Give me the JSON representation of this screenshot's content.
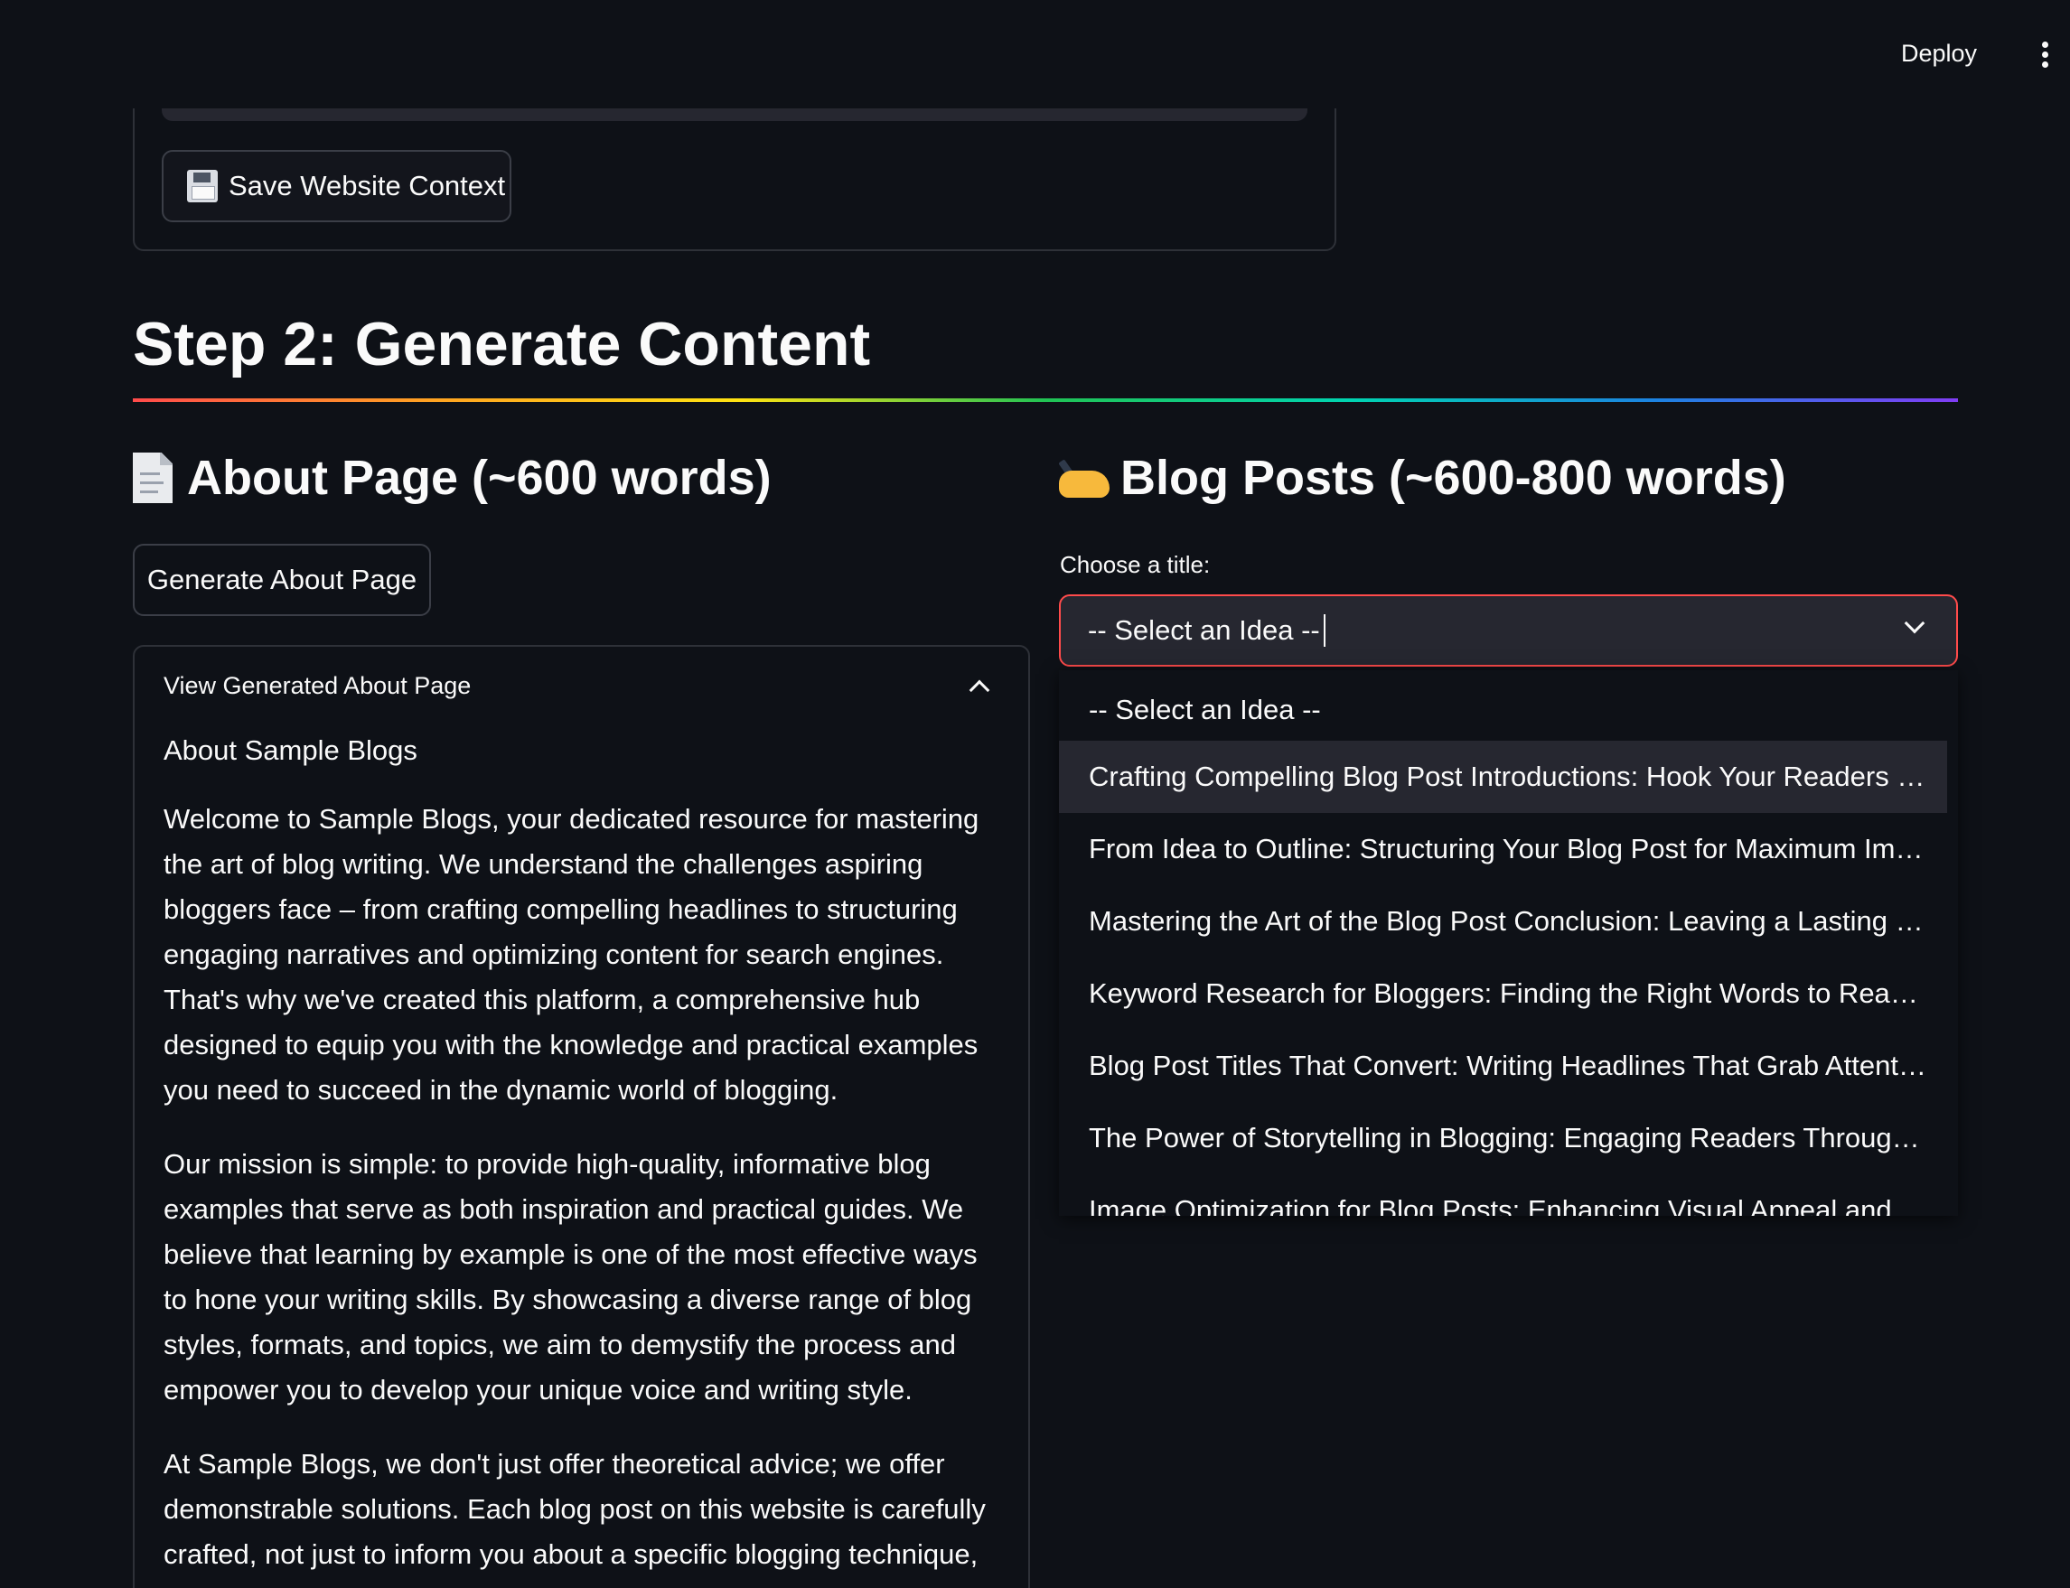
{
  "header": {
    "deploy_label": "Deploy",
    "menu_icon": "kebab-menu-icon"
  },
  "step1": {
    "save_button_label": "Save Website Context",
    "save_button_icon": "floppy-disk-icon"
  },
  "step2": {
    "title": "Step 2: Generate Content",
    "divider_colors": [
      "#ff4b4b",
      "#ffa421",
      "#ffe312",
      "#21c354",
      "#00d4b1",
      "#1c83e1",
      "#803df5"
    ]
  },
  "about": {
    "icon": "page-facing-up-icon",
    "heading": "About Page (~600 words)",
    "generate_button_label": "Generate About Page",
    "expander_label": "View Generated About Page",
    "expander_expanded": true,
    "page_title": "About Sample Blogs",
    "paragraphs": [
      "Welcome to Sample Blogs, your dedicated resource for mastering the art of blog writing. We understand the challenges aspiring bloggers face – from crafting compelling headlines to structuring engaging narratives and optimizing content for search engines. That's why we've created this platform, a comprehensive hub designed to equip you with the knowledge and practical examples you need to succeed in the dynamic world of blogging.",
      "Our mission is simple: to provide high-quality, informative blog examples that serve as both inspiration and practical guides. We believe that learning by example is one of the most effective ways to hone your writing skills. By showcasing a diverse range of blog styles, formats, and topics, we aim to demystify the process and empower you to develop your unique voice and writing style.",
      "At Sample Blogs, we don't just offer theoretical advice; we offer demonstrable solutions. Each blog post on this website is carefully crafted, not just to inform you about a specific blogging technique,"
    ]
  },
  "blog": {
    "icon": "writing-hand-icon",
    "heading": "Blog Posts (~600-800 words)",
    "select_label": "Choose a title:",
    "selected_value": "-- Select an Idea --",
    "highlighted_index": 1,
    "options": [
      "-- Select an Idea --",
      "Crafting Compelling Blog Post Introductions: Hook Your Readers fr…",
      "From Idea to Outline: Structuring Your Blog Post for Maximum Imp…",
      "Mastering the Art of the Blog Post Conclusion: Leaving a Lasting Im…",
      "Keyword Research for Bloggers: Finding the Right Words to Reach …",
      "Blog Post Titles That Convert: Writing Headlines That Grab Attention",
      "The Power of Storytelling in Blogging: Engaging Readers Through …",
      "Image Optimization for Blog Posts: Enhancing Visual Appeal and SEO"
    ]
  },
  "colors": {
    "background": "#0e1117",
    "input_bg": "#262730",
    "accent_red": "#ff4b4b",
    "text": "#fafafa",
    "border": "#2e3138"
  }
}
